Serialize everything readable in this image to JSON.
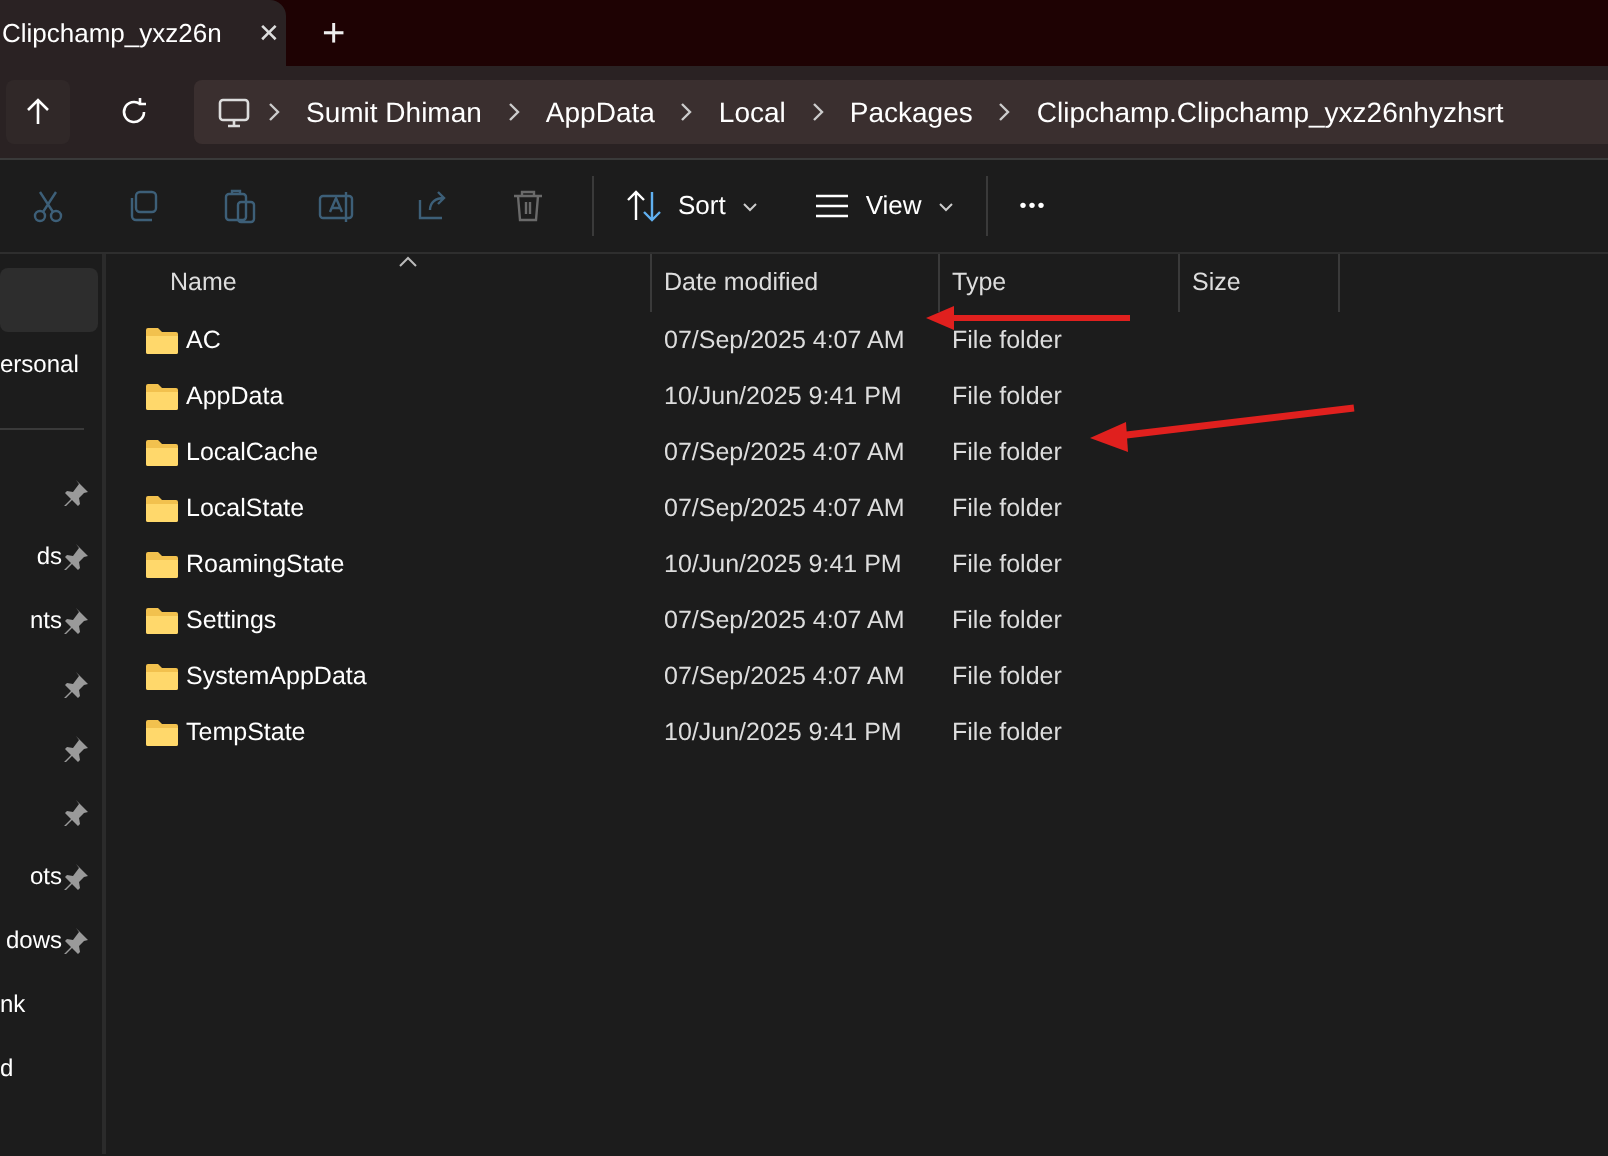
{
  "tab": {
    "title": "Clipchamp_yxz26n",
    "close": "✕",
    "new_tab": "+"
  },
  "breadcrumb": [
    "Sumit Dhiman",
    "AppData",
    "Local",
    "Packages",
    "Clipchamp.Clipchamp_yxz26nhyzhsrt"
  ],
  "toolbar": {
    "actions": [
      {
        "kind": "cut",
        "disabled": true
      },
      {
        "kind": "copy",
        "disabled": true
      },
      {
        "kind": "paste",
        "disabled": true
      },
      {
        "kind": "rename",
        "disabled": true
      },
      {
        "kind": "share",
        "disabled": true
      },
      {
        "kind": "delete",
        "disabled": true
      }
    ],
    "sort": "Sort",
    "view": "View",
    "more": "•••"
  },
  "sidebar": {
    "items": [
      {
        "selected": true,
        "pinned": false
      },
      {
        "label": "ersonal",
        "selected": false,
        "pinned": false
      },
      {
        "kind": "divider"
      },
      {
        "selected": false,
        "pinned": true
      },
      {
        "label": "ds",
        "selected": false,
        "pinned": true
      },
      {
        "label": "nts",
        "selected": false,
        "pinned": true
      },
      {
        "selected": false,
        "pinned": true
      },
      {
        "selected": false,
        "pinned": true
      },
      {
        "selected": false,
        "pinned": true
      },
      {
        "label": "ots",
        "selected": false,
        "pinned": true
      },
      {
        "label": "dows",
        "selected": false,
        "pinned": true
      },
      {
        "label": "nk",
        "selected": false,
        "pinned": false
      },
      {
        "label": "d",
        "selected": false,
        "pinned": false
      }
    ]
  },
  "table": {
    "columns": [
      "Name",
      "Date modified",
      "Type",
      "Size"
    ],
    "rows": [
      {
        "name": "AC",
        "date": "07/Sep/2025 4:07 AM",
        "type": "File folder",
        "arrow": {
          "kind": "level"
        }
      },
      {
        "name": "AppData",
        "date": "10/Jun/2025 9:41 PM",
        "type": "File folder"
      },
      {
        "name": "LocalCache",
        "date": "07/Sep/2025 4:07 AM",
        "type": "File folder",
        "arrow": {
          "kind": "rising"
        }
      },
      {
        "name": "LocalState",
        "date": "07/Sep/2025 4:07 AM",
        "type": "File folder"
      },
      {
        "name": "RoamingState",
        "date": "10/Jun/2025 9:41 PM",
        "type": "File folder"
      },
      {
        "name": "Settings",
        "date": "07/Sep/2025 4:07 AM",
        "type": "File folder"
      },
      {
        "name": "SystemAppData",
        "date": "07/Sep/2025 4:07 AM",
        "type": "File folder"
      },
      {
        "name": "TempState",
        "date": "10/Jun/2025 9:41 PM",
        "type": "File folder"
      }
    ]
  }
}
